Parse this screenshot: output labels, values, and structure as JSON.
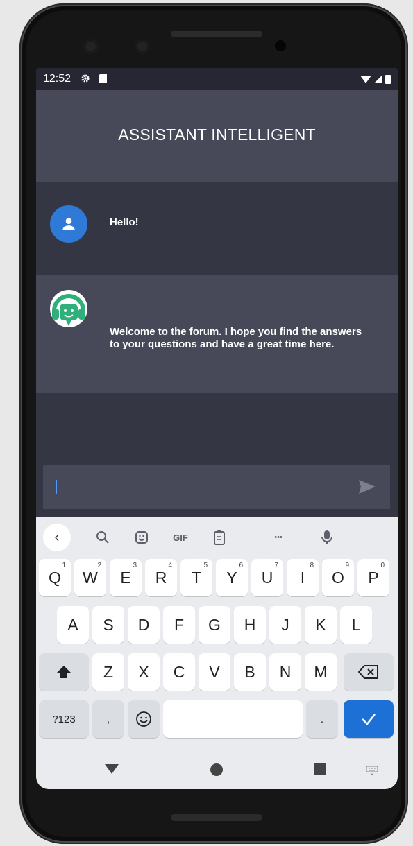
{
  "status_bar": {
    "time": "12:52",
    "icons": [
      "settings-icon",
      "sd-card-icon",
      "wifi-icon",
      "signal-icon",
      "battery-icon"
    ]
  },
  "app": {
    "title": "ASSISTANT INTELLIGENT"
  },
  "messages": [
    {
      "sender": "user",
      "avatar": "person-icon",
      "text": "Hello!"
    },
    {
      "sender": "bot",
      "avatar": "headset-bot-icon",
      "text": "Welcome to the forum. I hope you find the answers to your questions and have a great time here."
    }
  ],
  "input": {
    "value": "",
    "placeholder": ""
  },
  "keyboard": {
    "toolbar": {
      "gif_label": "GIF",
      "more_label": "•••",
      "back_glyph": "‹"
    },
    "row1": [
      "Q",
      "W",
      "E",
      "R",
      "T",
      "Y",
      "U",
      "I",
      "O",
      "P"
    ],
    "row1_hints": [
      "1",
      "2",
      "3",
      "4",
      "5",
      "6",
      "7",
      "8",
      "9",
      "0"
    ],
    "row2": [
      "A",
      "S",
      "D",
      "F",
      "G",
      "H",
      "J",
      "K",
      "L"
    ],
    "row3": [
      "Z",
      "X",
      "C",
      "V",
      "B",
      "N",
      "M"
    ],
    "row4": {
      "symbols_label": "?123",
      "comma_label": ",",
      "period_label": "."
    }
  },
  "colors": {
    "header": "#474958",
    "chat_bg": "#353644",
    "user_avatar": "#2f7ad7",
    "bot_avatar": "#2fb07b",
    "done_key": "#1d70d6",
    "cursor": "#4c9aff"
  }
}
